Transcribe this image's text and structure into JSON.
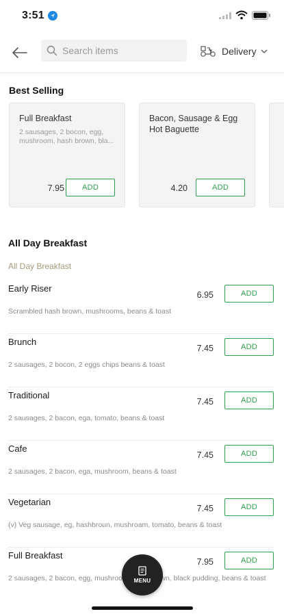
{
  "status_bar": {
    "time": "3:51"
  },
  "header": {
    "search_placeholder": "Search items",
    "delivery_label": "Delivery"
  },
  "best_selling": {
    "title": "Best Selling",
    "cards": [
      {
        "title": "Full Breakfast",
        "description": "2 sausages, 2 bocon, egg, mushroom, hash brown, bla...",
        "price": "7.95",
        "add_label": "ADD"
      },
      {
        "title": "Bacon, Sausage & Egg Hot Baguette",
        "description": "",
        "price": "4.20",
        "add_label": "ADD"
      }
    ]
  },
  "menu_section": {
    "title": "All Day Breakfast",
    "subtitle": "All Day Breakfast",
    "items": [
      {
        "name": "Early Riser",
        "price": "6.95",
        "description": "Scrambled hash brown, mushrooms, beans & toast",
        "add_label": "ADD"
      },
      {
        "name": "Brunch",
        "price": "7.45",
        "description": "2 sausages, 2 bocon, 2 eggs chips beans & toast",
        "add_label": "ADD"
      },
      {
        "name": "Traditional",
        "price": "7.45",
        "description": "2 sausages, 2 bacon, ega, tomato, beans & toast",
        "add_label": "ADD"
      },
      {
        "name": "Cafe",
        "price": "7.45",
        "description": "2 sausages, 2 bacon, ega, mushroom, beans & toast",
        "add_label": "ADD"
      },
      {
        "name": "Vegetarian",
        "price": "7.45",
        "description": "(v) Veg sausage, eg, hashbroun, mushroam, tomato, beans & toast",
        "add_label": "ADD"
      },
      {
        "name": "Full Breakfast",
        "price": "7.95",
        "description": "2 sausages, 2 bacon, egg, mushroom, hash brown, black pudding, beans & toast",
        "add_label": "ADD"
      }
    ]
  },
  "fab": {
    "label": "MENU"
  },
  "colors": {
    "accent_green": "#2ca24a",
    "subtitle_tan": "#a89a7a",
    "fab_dark": "#222222"
  }
}
